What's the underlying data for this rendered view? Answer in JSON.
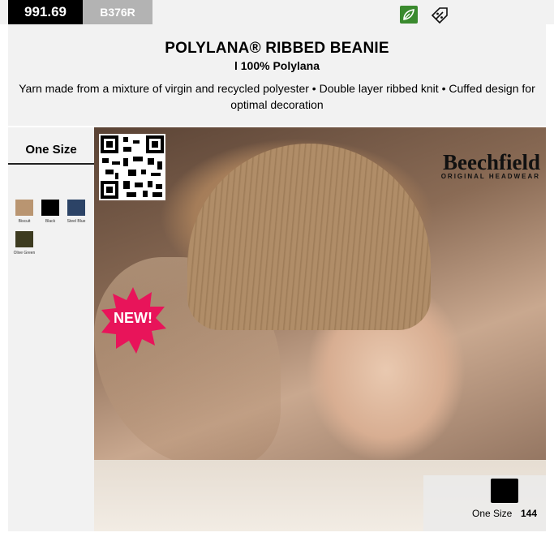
{
  "header_bar": {
    "code": "991.69",
    "sku": "B376R",
    "icons": [
      "recycled-leaf-icon",
      "percent-tag-icon"
    ]
  },
  "product": {
    "title": "POLYLANA® RIBBED BEANIE",
    "subtitle": "l 100% Polylana",
    "description": "Yarn made from a mixture of virgin and recycled polyester • Double layer ribbed knit • Cuffed design for optimal decoration"
  },
  "sidebar": {
    "size_label": "One Size",
    "colors": [
      {
        "name": "Biscuit",
        "hex": "#b99571"
      },
      {
        "name": "Black",
        "hex": "#000000"
      },
      {
        "name": "Steel Blue",
        "hex": "#2c4366"
      },
      {
        "name": "Olive Green",
        "hex": "#3d3b20"
      }
    ]
  },
  "photo": {
    "brand_main": "Beechfield",
    "brand_sub": "ORIGINAL HEADWEAR",
    "badge": "NEW!",
    "badge_color": "#e8145a"
  },
  "stock": {
    "size": "One Size",
    "quantity": "144"
  }
}
